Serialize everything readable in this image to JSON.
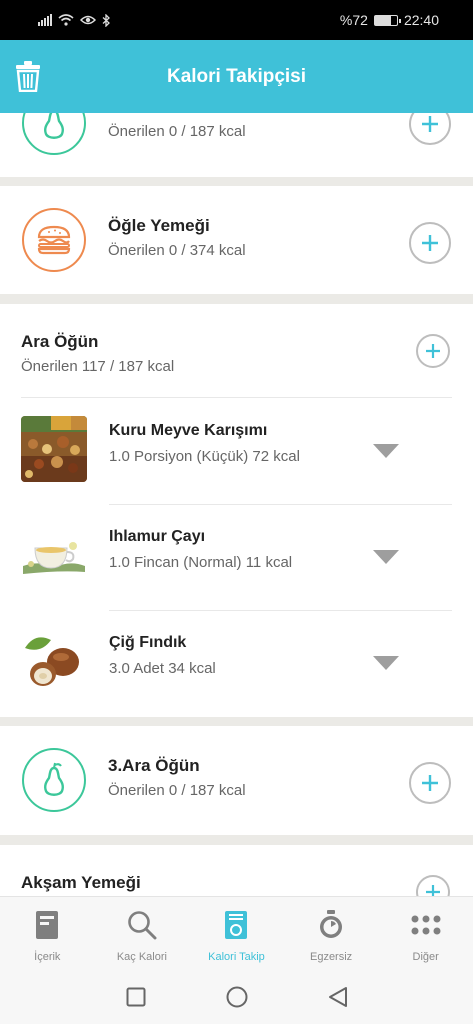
{
  "status": {
    "battery": "%72",
    "time": "22:40",
    "battery_level": 0.72
  },
  "app": {
    "title": "Kalori Takipçisi"
  },
  "meals": {
    "first_partial": {
      "recommended": "Önerilen 0 / 187 kcal"
    },
    "lunch": {
      "title": "Öğle Yemeği",
      "recommended": "Önerilen 0 / 374 kcal"
    },
    "snack": {
      "title": "Ara Öğün",
      "recommended": "Önerilen 117 / 187 kcal",
      "foods": [
        {
          "name": "Kuru Meyve Karışımı",
          "detail": "1.0 Porsiyon (Küçük) 72 kcal"
        },
        {
          "name": "Ihlamur Çayı",
          "detail": "1.0 Fincan (Normal) 11 kcal"
        },
        {
          "name": "Çiğ Fındık",
          "detail": "3.0 Adet 34 kcal"
        }
      ]
    },
    "snack3": {
      "title": "3.Ara Öğün",
      "recommended": "Önerilen 0 / 187 kcal"
    },
    "dinner": {
      "title": "Akşam Yemeği"
    }
  },
  "nav": {
    "items": [
      {
        "label": "İçerik",
        "icon": "document-icon"
      },
      {
        "label": "Kaç Kalori",
        "icon": "search-icon"
      },
      {
        "label": "Kalori Takip",
        "icon": "scale-icon"
      },
      {
        "label": "Egzersiz",
        "icon": "stopwatch-icon"
      },
      {
        "label": "Diğer",
        "icon": "grid-icon"
      }
    ],
    "active_index": 2
  },
  "colors": {
    "accent": "#3fc1d8",
    "orange": "#ee8a4f",
    "green": "#3cc79a"
  }
}
